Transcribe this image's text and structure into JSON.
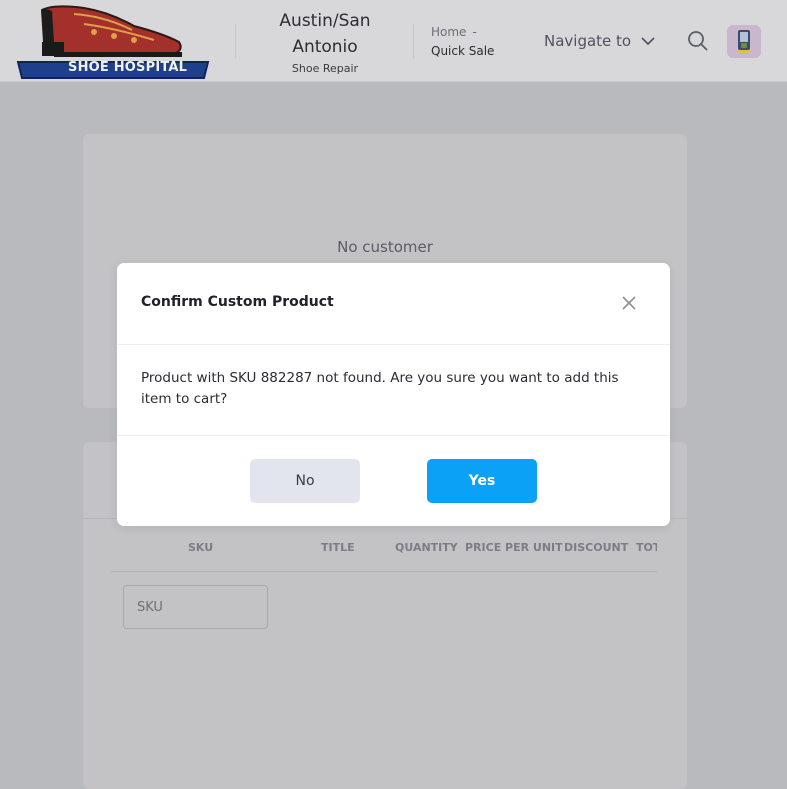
{
  "header": {
    "logo_text": "SHOE HOSPITAL",
    "store_name": "Austin/San Antonio",
    "store_subtitle": "Shoe Repair",
    "breadcrumb": {
      "home": "Home",
      "separator": "-",
      "current": "Quick Sale"
    },
    "navigate_label": "Navigate to"
  },
  "customer_card": {
    "empty_text": "No customer"
  },
  "cart": {
    "columns": [
      "SKU",
      "TITLE",
      "QUANTITY",
      "PRICE PER UNIT",
      "DISCOUNT",
      "TOT"
    ],
    "sku_placeholder": "SKU"
  },
  "modal": {
    "title": "Confirm Custom Product",
    "message": "Product with SKU 882287 not found. Are you sure you want to add this item to cart?",
    "no_label": "No",
    "yes_label": "Yes"
  },
  "colors": {
    "primary": "#0ba1f6",
    "overlay_bg": "#b9babe",
    "secondary_button": "#e3e5ee"
  }
}
